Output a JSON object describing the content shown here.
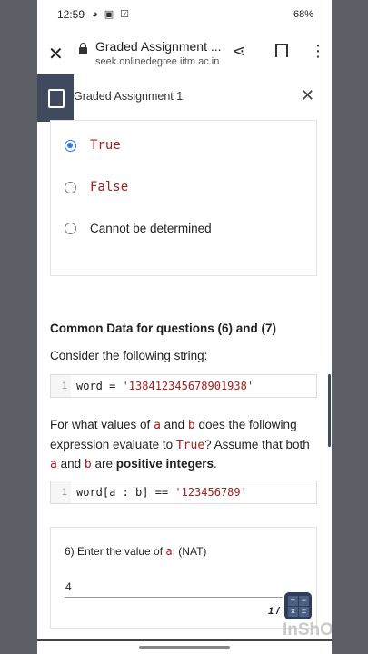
{
  "status_bar": {
    "time": "12:59",
    "icons": "◕ ▣ ☑",
    "right": "68%"
  },
  "browser": {
    "title": "Graded Assignment ...",
    "url": "seek.onlinedegree.iitm.ac.in"
  },
  "assignment": {
    "title": "Graded Assignment 1"
  },
  "question_options": [
    {
      "label": "True",
      "code": true,
      "selected": true
    },
    {
      "label": "False",
      "code": true,
      "selected": false
    },
    {
      "label": "Cannot be determined",
      "code": false,
      "selected": false
    }
  ],
  "common_data": {
    "heading": "Common Data for questions (6) and (7)",
    "intro": "Consider the following string:",
    "code1": {
      "line": "1",
      "lhs": "word = ",
      "str": "'138412345678901938'"
    },
    "para_parts": {
      "p1": "For what values of ",
      "a": "a",
      "p2": " and ",
      "b": "b",
      "p3": " does the following expression evaluate to ",
      "true": "True",
      "p4": "? Assume that both ",
      "a2": "a",
      "p5": " and ",
      "b2": "b",
      "p6": " are ",
      "bold": "positive integers",
      "p7": "."
    },
    "code2": {
      "line": "1",
      "lhs": "word[a : b] == ",
      "str": "'123456789'"
    }
  },
  "q6": {
    "prefix": "6) Enter the value of ",
    "var": "a",
    "suffix": ". (NAT)",
    "answer": "4"
  },
  "page_fraction": "1 /",
  "watermark": "InShOt"
}
